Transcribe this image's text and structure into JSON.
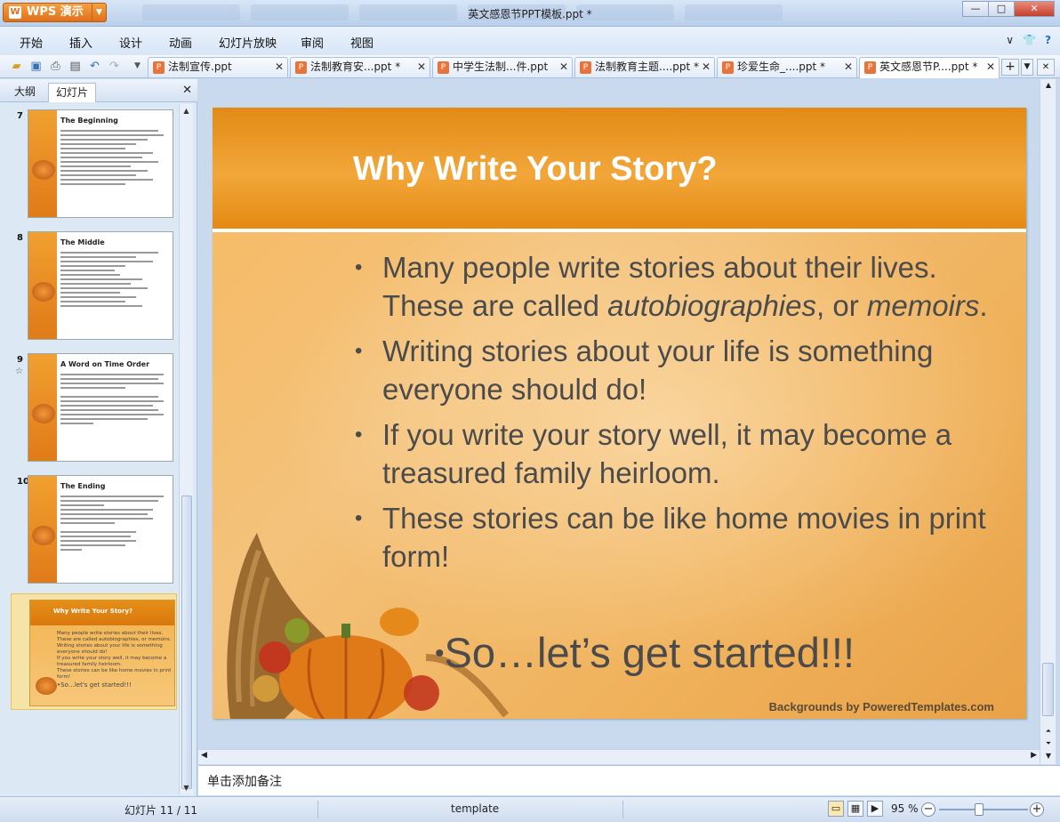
{
  "app": {
    "brand": "WPS 演示",
    "window_title": "英文感恩节PPT模板.ppt *"
  },
  "window_controls": {
    "minimize": "—",
    "maximize": "□",
    "close": "✕"
  },
  "menu": [
    "开始",
    "插入",
    "设计",
    "动画",
    "幻灯片放映",
    "审阅",
    "视图"
  ],
  "menu_right": {
    "collapse": "∨",
    "skin": "👕",
    "help": "?"
  },
  "doc_tabs": [
    {
      "label": "法制宣传.ppt",
      "active": false
    },
    {
      "label": "法制教育安...ppt *",
      "active": false
    },
    {
      "label": "中学生法制...件.ppt",
      "active": false
    },
    {
      "label": "法制教育主题....ppt *",
      "active": false
    },
    {
      "label": "珍爱生命_....ppt *",
      "active": false
    },
    {
      "label": "英文感恩节P....ppt *",
      "active": true
    }
  ],
  "left_pane": {
    "tab_outline": "大纲",
    "tab_slides": "幻灯片",
    "close": "✕",
    "thumbnails": [
      {
        "num": "7",
        "title": "The Beginning"
      },
      {
        "num": "8",
        "title": "The Middle"
      },
      {
        "num": "9",
        "title": "A Word on Time Order",
        "star": "☆"
      },
      {
        "num": "10",
        "title": "The Ending"
      },
      {
        "num": "11",
        "title": "Why Write Your Story?",
        "lines": [
          "Many people write stories about their lives. These are called autobiographies, or memoirs.",
          "Writing stories about your life is something everyone should do!",
          "If you write your story well, it may become a treasured family heirloom.",
          "These stories can be like home movies in print form!",
          "•So…let's get started!!!"
        ]
      }
    ]
  },
  "slide": {
    "title": "Why Write Your Story?",
    "bullets": [
      {
        "before": "Many people write stories about their lives. These are called ",
        "em1": "autobiographies",
        "middle": ", or ",
        "em2": "memoirs",
        "after": "."
      },
      {
        "text": "Writing stories about your life is something everyone should do!"
      },
      {
        "text": "If you write your story well, it may become a treasured family heirloom."
      },
      {
        "text": "These stories can be like home movies in print form!"
      }
    ],
    "closing": "So…let’s get started!!!",
    "credit": "Backgrounds by PoweredTemplates.com"
  },
  "notes_placeholder": "单击添加备注",
  "status": {
    "slide_counter": "幻灯片 11 / 11",
    "template": "template",
    "zoom": "95 %"
  },
  "colors": {
    "accent": "#e0701a",
    "slide_band": "#e28a16",
    "body_text": "#4b4b4b"
  }
}
